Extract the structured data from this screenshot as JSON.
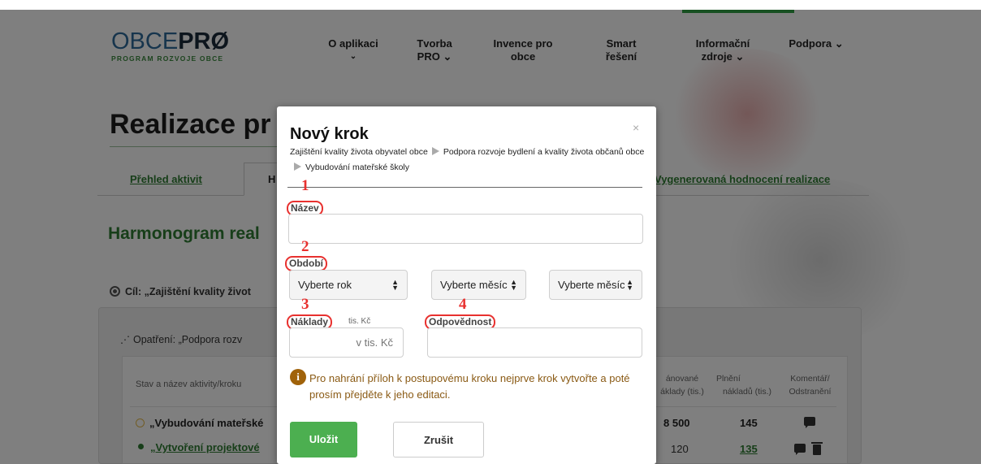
{
  "logo": {
    "light": "OBCE",
    "bold": "PRØ",
    "tagline": "PROGRAM ROZVOJE OBCE"
  },
  "nav": {
    "items": [
      {
        "label_line1": "O aplikaci",
        "label_line2": "⌄"
      },
      {
        "label_line1": "Tvorba",
        "label_line2": "PRO ⌄"
      },
      {
        "label_line1": "Invence pro",
        "label_line2": "obce"
      },
      {
        "label_line1": "Smart",
        "label_line2": "řešení"
      },
      {
        "label_line1": "Informační",
        "label_line2": "zdroje ⌄"
      },
      {
        "label_line1": "Podpora ⌄",
        "label_line2": ""
      }
    ]
  },
  "page": {
    "title": "Realizace pr",
    "tabs": [
      "Přehled aktivit",
      "H",
      "Vygenerovaná hodnocení realizace"
    ],
    "harmonogram_title": "Harmonogram real",
    "goal": "Cíl: „Zajištění kvality život",
    "measure": "Opatření: „Podpora rozv",
    "table": {
      "header_left": "Stav a název aktivity/kroku",
      "header_planned": [
        "ánované",
        "áklady (tis.)"
      ],
      "header_fulfilled": [
        "Plnění",
        "nákladů (tis.)"
      ],
      "header_comment": [
        "Komentář/",
        "Odstranění"
      ],
      "rows": [
        {
          "name": "„Vybudování mateřské",
          "planned": "8 500",
          "fulfilled": "145"
        },
        {
          "name": "„Vytvoření projektové",
          "planned": "120",
          "fulfilled": "135"
        }
      ]
    }
  },
  "modal": {
    "title": "Nový krok",
    "close": "×",
    "breadcrumb": [
      "Zajištění kvality života obyvatel obce",
      "Podpora rozvoje bydlení a kvality života občanů obce",
      "Vybudování mateřské školy"
    ],
    "fields": {
      "name": {
        "number": "1",
        "label": "Název",
        "value": ""
      },
      "period": {
        "number": "2",
        "label": "Období",
        "year_select": "Vyberte rok",
        "month_from_select": "Vyberte měsíc",
        "month_to_select": "Vyberte měsíc"
      },
      "costs": {
        "number": "3",
        "label": "Náklady",
        "unit": "tis. Kč",
        "placeholder": "v tis. Kč"
      },
      "responsibility": {
        "number": "4",
        "label": "Odpovědnost",
        "value": ""
      }
    },
    "info_icon": "i",
    "info_text": "Pro nahrání příloh k postupovému kroku nejprve krok vytvořte a poté prosím přejděte k jeho editaci.",
    "save_label": "Uložit",
    "cancel_label": "Zrušit"
  },
  "colors": {
    "accent_green": "#4caf50",
    "annotation_red": "#e8312f",
    "info_brown": "#8a5a14"
  }
}
